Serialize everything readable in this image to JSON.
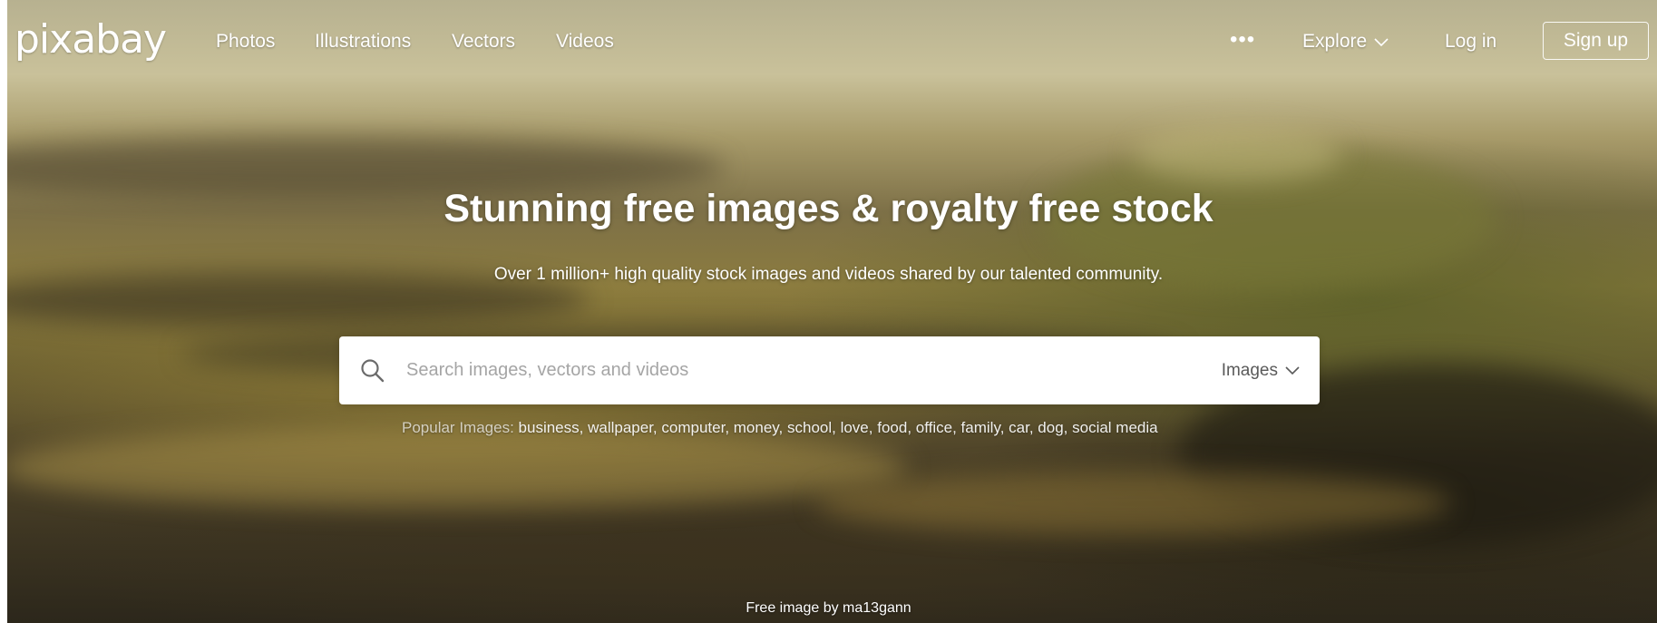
{
  "header": {
    "logo": "pixabay",
    "nav": [
      {
        "label": "Photos"
      },
      {
        "label": "Illustrations"
      },
      {
        "label": "Vectors"
      },
      {
        "label": "Videos"
      }
    ],
    "more": "•••",
    "explore": "Explore",
    "login": "Log in",
    "signup": "Sign up"
  },
  "hero": {
    "title": "Stunning free images & royalty free stock",
    "subtitle": "Over 1 million+ high quality stock images and videos shared by our talented community."
  },
  "search": {
    "placeholder": "Search images, vectors and videos",
    "value": "",
    "type_label": "Images",
    "icon": "search-icon"
  },
  "popular": {
    "label": "Popular Images:",
    "terms": [
      "business",
      "wallpaper",
      "computer",
      "money",
      "school",
      "love",
      "food",
      "office",
      "family",
      "car",
      "dog",
      "social media"
    ]
  },
  "credit": "Free image by ma13gann",
  "colors": {
    "text": "#ffffff",
    "search_bg": "#ffffff",
    "placeholder": "#a5a5a5"
  }
}
